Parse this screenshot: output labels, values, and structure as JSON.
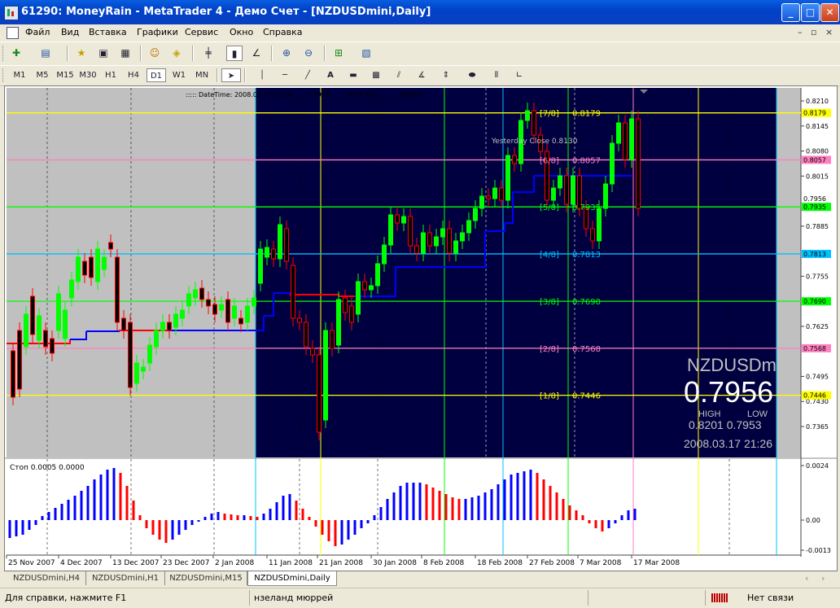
{
  "window": {
    "title": "61290: MoneyRain - MetaTrader 4 - Демо Счет - [NZDUSDmini,Daily]",
    "minimize": "_",
    "maximize": "□",
    "close": "✕"
  },
  "menu": {
    "items": [
      "Файл",
      "Вид",
      "Вставка",
      "Графики",
      "Сервис",
      "Окно",
      "Справка"
    ],
    "mdi_controls": [
      "–",
      "▫",
      "×"
    ]
  },
  "toolbar1": {
    "icons": [
      "new-chart-icon",
      "profiles-icon",
      "market-watch-icon",
      "navigator-icon",
      "terminal-icon",
      "expert-advisors-icon",
      "autotrading-icon",
      "bar-chart-icon",
      "candlestick-icon",
      "line-chart-icon",
      "zoom-in-icon",
      "zoom-out-icon",
      "indicators-icon",
      "templates-icon"
    ]
  },
  "toolbar2": {
    "timeframes": [
      "M1",
      "M5",
      "M15",
      "M30",
      "H1",
      "H4",
      "D1",
      "W1",
      "MN"
    ],
    "active_timeframe": "D1",
    "tools": [
      "cursor-icon",
      "vertical-line-icon",
      "horizontal-line-icon",
      "trendline-icon",
      "text-icon",
      "rectangle-icon",
      "fibonacci-icon",
      "andrews-pitchfork-icon",
      "gann-icon",
      "arrows-icon",
      "ellipse-icon",
      "cycle-lines-icon",
      "trend-angle-icon"
    ]
  },
  "chart": {
    "header_text": "::::: DateTime: 2008.03.17 21:26 ..... 0.7956 ...... 2007 Volu ........ Default",
    "symbol_watermark": "NZDUSDmi",
    "bid": "0.7956",
    "high_label": "HIGH",
    "low_label": "LOW",
    "high_low": "0.8201  0.7953",
    "datetime": "2008.03.17 21:26",
    "yesterday_close": "Yesterday Close 0.8130",
    "murrey_levels": [
      {
        "label": "[7/8]",
        "value": "0.8179",
        "color": "#ffff00"
      },
      {
        "label": "[6/8]",
        "value": "0.8057",
        "color": "#ff80c0"
      },
      {
        "label": "[5/8]",
        "value": "0.7935",
        "color": "#00ff00"
      },
      {
        "label": "[4/8]",
        "value": "0.7813",
        "color": "#00c0ff"
      },
      {
        "label": "[3/8]",
        "value": "0.7690",
        "color": "#00ff00"
      },
      {
        "label": "[2/8]",
        "value": "0.7568",
        "color": "#ff80c0"
      },
      {
        "label": "[1/8]",
        "value": "0.7446",
        "color": "#ffff00"
      }
    ],
    "price_ticks": [
      "0.8210",
      "0.8145",
      "0.8080",
      "0.8015",
      "0.7885",
      "0.7755",
      "0.7625",
      "0.7495",
      "0.7430",
      "0.7365"
    ],
    "price_tags": [
      {
        "value": "0.8179",
        "color": "#ffff00"
      },
      {
        "value": "0.8057",
        "color": "#ff80c0"
      },
      {
        "value": "0.7956",
        "color": "#ffffff"
      },
      {
        "value": "0.7935",
        "color": "#00ff00"
      },
      {
        "value": "0.7813",
        "color": "#00c0ff"
      },
      {
        "value": "0.7690",
        "color": "#00ff00"
      },
      {
        "value": "0.7568",
        "color": "#ff80c0"
      },
      {
        "value": "0.7446",
        "color": "#ffff00"
      }
    ],
    "date_ticks": [
      "25 Nov 2007",
      "4 Dec 2007",
      "13 Dec 2007",
      "23 Dec 2007",
      "2 Jan 2008",
      "11 Jan 2008",
      "21 Jan 2008",
      "30 Jan 2008",
      "8 Feb 2008",
      "18 Feb 2008",
      "27 Feb 2008",
      "7 Mar 2008",
      "17 Mar 2008"
    ]
  },
  "subwindow": {
    "label": "Стоп 0.0005 0.0000",
    "ticks": [
      "0.0024",
      "0.00",
      "-0.0013"
    ]
  },
  "tabs": [
    "NZDUSDmini,H4",
    "NZDUSDmini,H1",
    "NZDUSDmini,M15",
    "NZDUSDmini,Daily"
  ],
  "active_tab": "NZDUSDmini,Daily",
  "tab_scroll": [
    "‹",
    "›"
  ],
  "status": {
    "help": "Для справки, нажмите F1",
    "profile": "нзеланд мюррей",
    "connection": "Нет связи"
  },
  "colors": {
    "chart_bg_left": "#c0c0c0",
    "chart_bg_right": "#000040",
    "bull": "#00ff00",
    "bear": "#ff0000",
    "hist_up": "#0000ff",
    "hist_down": "#ff0000"
  }
}
